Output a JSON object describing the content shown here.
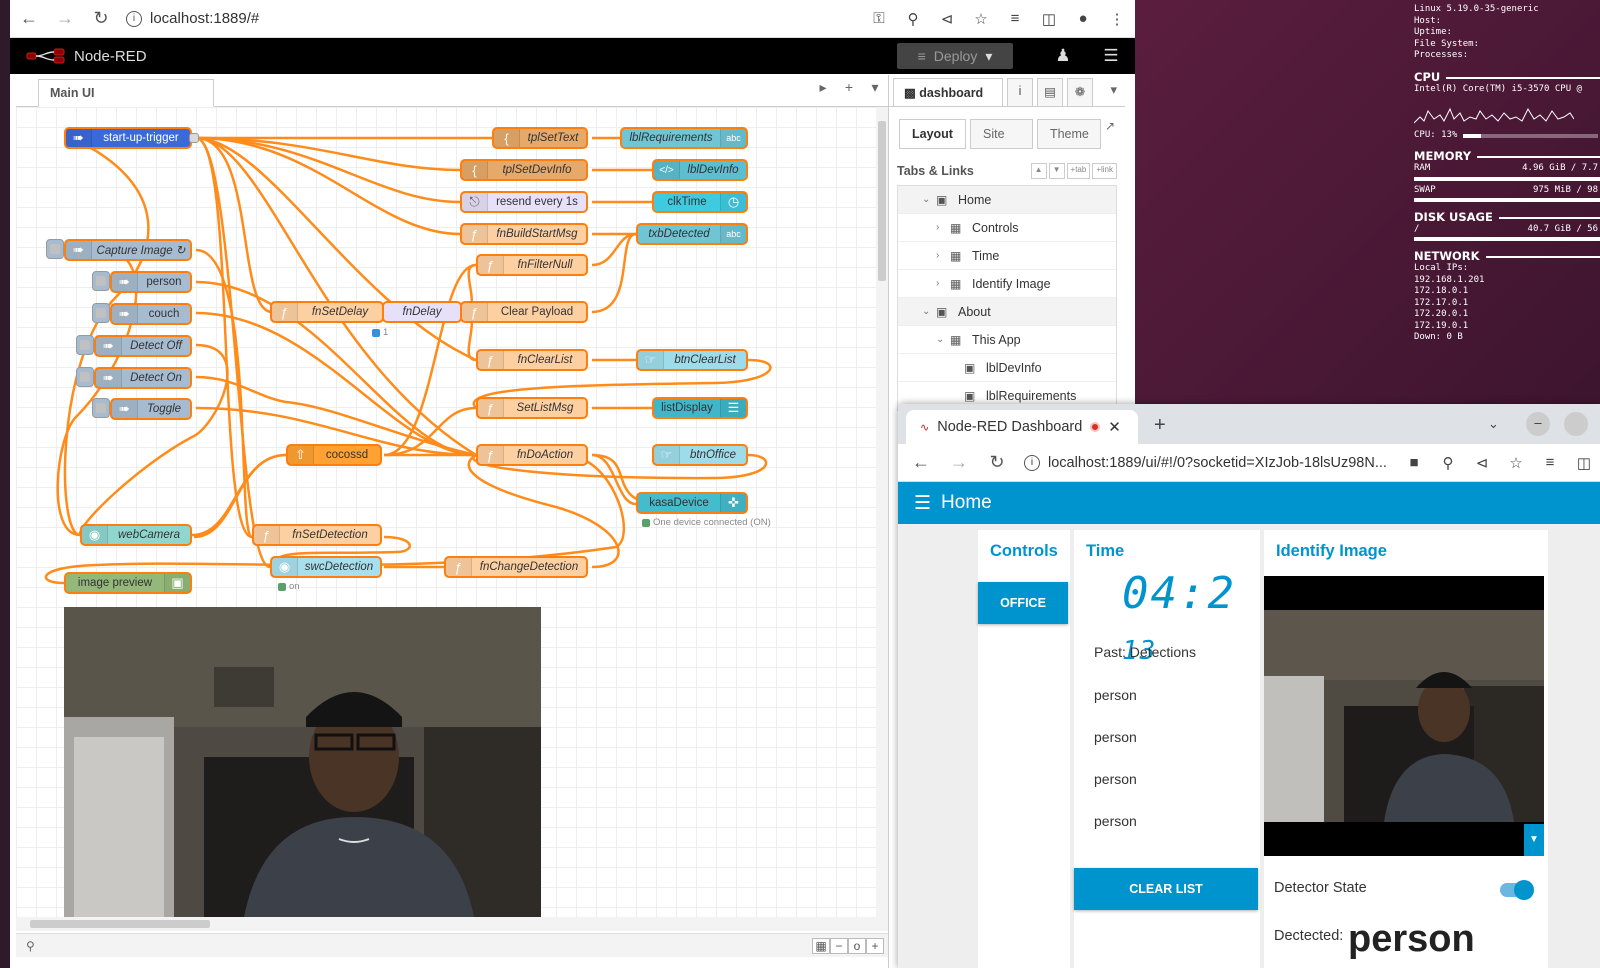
{
  "browser_left": {
    "url": "localhost:1889/#"
  },
  "nodered": {
    "app_title": "Node-RED",
    "deploy_label": "Deploy",
    "flow_tab": "Main UI",
    "nodes": {
      "start_up_trigger": "start-up-trigger",
      "capture_image": "Capture Image ↻",
      "person": "person",
      "couch": "couch",
      "detect_off": "Detect Off",
      "detect_on": "Detect On",
      "toggle": "Toggle",
      "tplSetText": "tplSetText",
      "tplSetDevInfo": "tplSetDevInfo",
      "resend": "resend every 1s",
      "fnBuildStartMsg": "fnBuildStartMsg",
      "fnFilterNull": "fnFilterNull",
      "fnSetDelay": "fnSetDelay",
      "fnDelay": "fnDelay",
      "clear_payload": "Clear Payload",
      "fnClearList": "fnClearList",
      "setListMsg": "SetListMsg",
      "cocossd": "cocossd",
      "fnDoAction": "fnDoAction",
      "webCamera": "webCamera",
      "fnSetDetection": "fnSetDetection",
      "swcDetection": "swcDetection",
      "fnChangeDetection": "fnChangeDetection",
      "image_preview": "image preview",
      "lblRequirements": "lblRequirements",
      "lblDevInfo": "lblDevInfo",
      "clkTime": "clkTime",
      "txbDetected": "txbDetected",
      "btnClearList": "btnClearList",
      "listDisplay": "listDisplay",
      "btnOffice": "btnOffice",
      "kasaDevice": "kasaDevice"
    },
    "status": {
      "delay_count": "1",
      "kasa": "One device connected (ON)",
      "switch_on": "on"
    }
  },
  "sidebar": {
    "active_tab": "dashboard",
    "subtabs": [
      "Layout",
      "Site",
      "Theme"
    ],
    "section_title": "Tabs & Links",
    "section_buttons": [
      "▲",
      "▼",
      "+tab",
      "+link"
    ],
    "tree": [
      {
        "label": "Home"
      },
      {
        "label": "Controls"
      },
      {
        "label": "Time"
      },
      {
        "label": "Identify Image"
      },
      {
        "label": "About"
      },
      {
        "label": "This App"
      },
      {
        "label": "lblDevInfo"
      },
      {
        "label": "lblRequirements"
      }
    ]
  },
  "browser_right": {
    "tab_title": "Node-RED Dashboard",
    "url": "localhost:1889/ui/#!/0?socketid=XIzJob-18lsUz98N..."
  },
  "dashboard": {
    "title": "Home",
    "groups": {
      "controls": "Controls",
      "time": "Time",
      "identify": "Identify Image"
    },
    "office_button": "OFFICE",
    "clock_main": "04:2",
    "clock_sec": "13",
    "list_title": "Past: Detections",
    "list_items": [
      "person",
      "person",
      "person",
      "person"
    ],
    "clear_button": "CLEAR LIST",
    "detector_state_label": "Detector State",
    "detector_state_on": true,
    "detected_label": "Dectected:",
    "detected_value": "person"
  },
  "conky": {
    "sys_lines": [
      "Linux 5.19.0-35-generic",
      "Host:",
      "Uptime:",
      "File System:",
      "Processes:"
    ],
    "cpu_title": "CPU",
    "cpu_model": "Intel(R) Core(TM) i5-3570 CPU @",
    "cpu_usage": "CPU: 13%",
    "cpu_fraction": 0.13,
    "memory_title": "MEMORY",
    "ram_label": "RAM",
    "ram_value": "4.96 GiB / 7.7",
    "swap_label": "SWAP",
    "swap_value": "975 MiB / 98",
    "disk_title": "DISK USAGE",
    "disk_label": "/",
    "disk_value": "40.7 GiB / 56",
    "network_title": "NETWORK",
    "net_lines": [
      "Local IPs:",
      "192.168.1.201",
      "172.18.0.1",
      "172.17.0.1",
      "172.20.0.1",
      "172.19.0.1",
      "Down: 0 B"
    ]
  },
  "colors": {
    "wire": "#ff8c1a",
    "dashboard_accent": "#0094ce",
    "nr_header": "#000000"
  }
}
